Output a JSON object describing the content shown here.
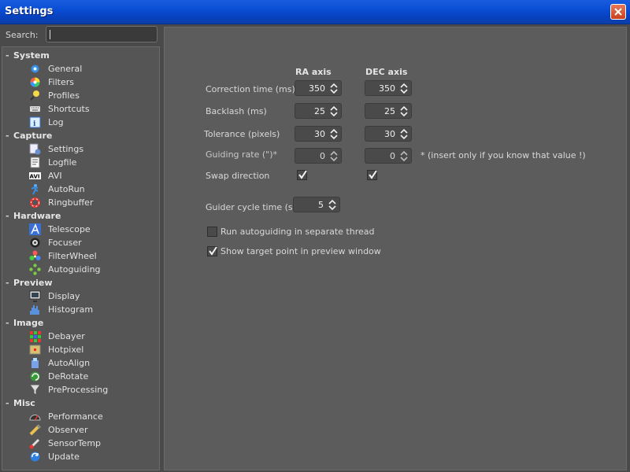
{
  "window": {
    "title": "Settings"
  },
  "search": {
    "label": "Search:",
    "value": ""
  },
  "tree": [
    {
      "category": "System",
      "items": [
        {
          "label": "General",
          "icon": "gear-icon"
        },
        {
          "label": "Filters",
          "icon": "color-wheel-icon"
        },
        {
          "label": "Profiles",
          "icon": "profiles-icon"
        },
        {
          "label": "Shortcuts",
          "icon": "keyboard-icon"
        },
        {
          "label": "Log",
          "icon": "log-icon"
        }
      ]
    },
    {
      "category": "Capture",
      "items": [
        {
          "label": "Settings",
          "icon": "capture-settings-icon"
        },
        {
          "label": "Logfile",
          "icon": "logfile-icon"
        },
        {
          "label": "AVI",
          "icon": "avi-icon"
        },
        {
          "label": "AutoRun",
          "icon": "autorun-icon"
        },
        {
          "label": "Ringbuffer",
          "icon": "ringbuffer-icon"
        }
      ]
    },
    {
      "category": "Hardware",
      "items": [
        {
          "label": "Telescope",
          "icon": "telescope-icon"
        },
        {
          "label": "Focuser",
          "icon": "focuser-icon"
        },
        {
          "label": "FilterWheel",
          "icon": "filterwheel-icon"
        },
        {
          "label": "Autoguiding",
          "icon": "autoguiding-icon"
        }
      ]
    },
    {
      "category": "Preview",
      "items": [
        {
          "label": "Display",
          "icon": "display-icon"
        },
        {
          "label": "Histogram",
          "icon": "histogram-icon"
        }
      ]
    },
    {
      "category": "Image",
      "items": [
        {
          "label": "Debayer",
          "icon": "debayer-icon"
        },
        {
          "label": "Hotpixel",
          "icon": "hotpixel-icon"
        },
        {
          "label": "AutoAlign",
          "icon": "autoalign-icon"
        },
        {
          "label": "DeRotate",
          "icon": "derotate-icon"
        },
        {
          "label": "PreProcessing",
          "icon": "funnel-icon"
        }
      ]
    },
    {
      "category": "Misc",
      "items": [
        {
          "label": "Performance",
          "icon": "gauge-icon"
        },
        {
          "label": "Observer",
          "icon": "observer-icon"
        },
        {
          "label": "SensorTemp",
          "icon": "thermometer-icon"
        },
        {
          "label": "Update",
          "icon": "update-icon"
        }
      ]
    }
  ],
  "panel": {
    "headers": {
      "ra": "RA axis",
      "dec": "DEC axis"
    },
    "rows": [
      {
        "label": "Correction time (ms)",
        "ra": "350",
        "dec": "350"
      },
      {
        "label": "Backlash (ms)",
        "ra": "25",
        "dec": "25"
      },
      {
        "label": "Tolerance (pixels)",
        "ra": "30",
        "dec": "30"
      },
      {
        "label": "Guiding rate (\")*",
        "ra": "0",
        "dec": "0"
      }
    ],
    "guiding_rate_note": "* (insert only if you know that value !)",
    "swap_direction": {
      "label": "Swap direction",
      "ra_checked": true,
      "dec_checked": true
    },
    "cycle_time": {
      "label": "Guider cycle time (s)",
      "value": "5"
    },
    "options": [
      {
        "label": "Run autoguiding in separate thread",
        "checked": false
      },
      {
        "label": "Show target point in preview window",
        "checked": true
      }
    ]
  }
}
